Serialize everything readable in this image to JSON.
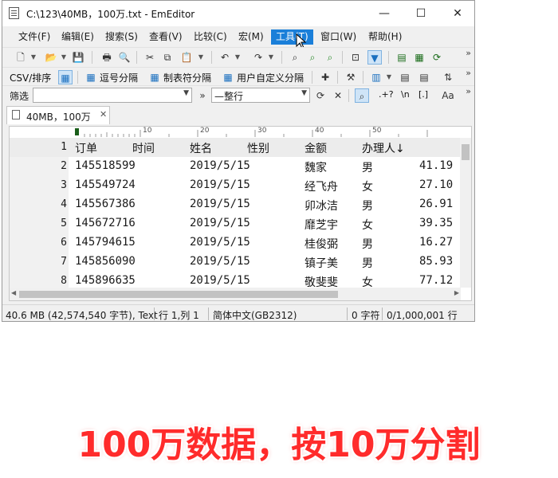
{
  "window": {
    "title": "C:\\123\\40MB，100万.txt - EmEditor",
    "minimize": "—",
    "maximize": "☐",
    "close": "✕"
  },
  "menu": [
    "文件(F)",
    "编辑(E)",
    "搜索(S)",
    "查看(V)",
    "比较(C)",
    "宏(M)",
    "工具(T)",
    "窗口(W)",
    "帮助(H)"
  ],
  "menu_active_index": 6,
  "toolbar3": {
    "csv_sort": "CSV/排序",
    "comma": "逗号分隔",
    "tab": "制表符分隔",
    "user": "用户自定义分隔"
  },
  "filterbar": {
    "label": "筛选",
    "filter_value": "",
    "mode": "—整行",
    "regex_dots": ".+?",
    "newline": "\\n",
    "brackets": "[.]"
  },
  "tab": {
    "label": "40MB，100万"
  },
  "ruler": {
    "m10": "10",
    "m20": "20",
    "m30": "30",
    "m40": "40",
    "m50": "50"
  },
  "table": {
    "headers": [
      "订单",
      "时间",
      "姓名",
      "性别",
      "金额",
      "办理人↓"
    ],
    "rows": [
      {
        "ln": "1",
        "id": "",
        "date": "",
        "name": "",
        "sex": "",
        "amount": ""
      },
      {
        "ln": "2",
        "id": "145518599",
        "date": "2019/5/15",
        "name": "魏家",
        "sex": "男",
        "amount": "41.19"
      },
      {
        "ln": "3",
        "id": "145549724",
        "date": "2019/5/15",
        "name": "经飞舟",
        "sex": "女",
        "amount": "27.10"
      },
      {
        "ln": "4",
        "id": "145567386",
        "date": "2019/5/15",
        "name": "卯冰洁",
        "sex": "男",
        "amount": "26.91"
      },
      {
        "ln": "5",
        "id": "145672716",
        "date": "2019/5/15",
        "name": "靡芝宇",
        "sex": "女",
        "amount": "39.35"
      },
      {
        "ln": "6",
        "id": "145794615",
        "date": "2019/5/15",
        "name": "桂俊弼",
        "sex": "男",
        "amount": "16.27"
      },
      {
        "ln": "7",
        "id": "145856090",
        "date": "2019/5/15",
        "name": "镇子美",
        "sex": "男",
        "amount": "85.93"
      },
      {
        "ln": "8",
        "id": "145896635",
        "date": "2019/5/15",
        "name": "敬斐斐",
        "sex": "女",
        "amount": "77.12"
      }
    ]
  },
  "status": {
    "size": "40.6 MB (42,574,540 字节), Text",
    "position": "行 1,列 1",
    "encoding": "简体中文(GB2312)",
    "chars": "0 字符",
    "lines": "0/1,000,001 行"
  },
  "caption": "100万数据，按10万分割",
  "colors": {
    "accent": "#1a7fd9",
    "caption": "#ff2b2b"
  }
}
